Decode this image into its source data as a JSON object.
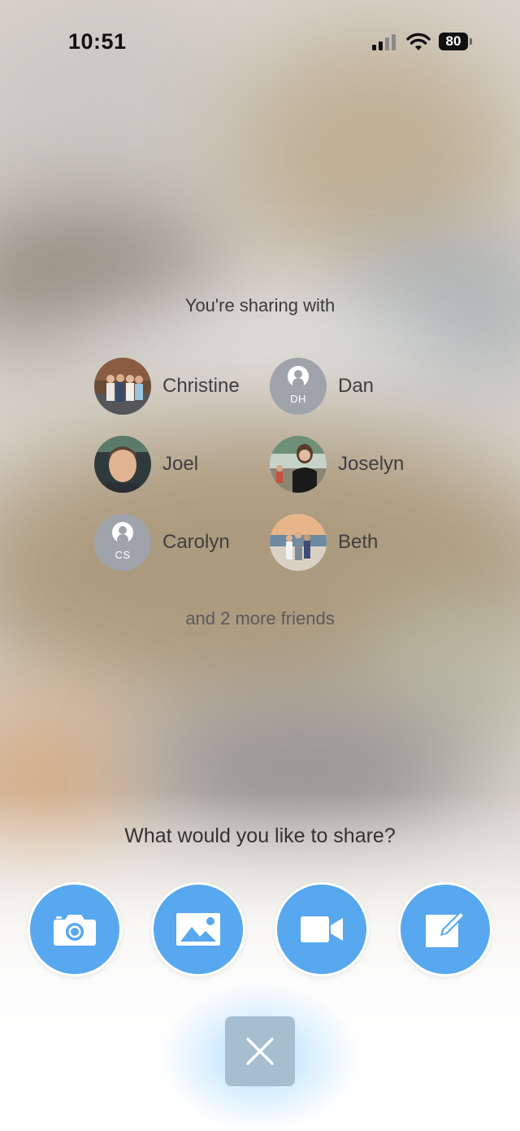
{
  "status_bar": {
    "time": "10:51",
    "battery": "80"
  },
  "sharing": {
    "heading": "You're sharing with",
    "friends": [
      {
        "name": "Christine",
        "avatar": "photo"
      },
      {
        "name": "Dan",
        "avatar": "generic",
        "initials": "DH"
      },
      {
        "name": "Joel",
        "avatar": "photo"
      },
      {
        "name": "Joselyn",
        "avatar": "photo"
      },
      {
        "name": "Carolyn",
        "avatar": "generic",
        "initials": "CS"
      },
      {
        "name": "Beth",
        "avatar": "photo"
      }
    ],
    "more": "and 2 more friends"
  },
  "share_prompt": "What would you like to share?",
  "actions": [
    {
      "icon": "camera-icon"
    },
    {
      "icon": "image-icon"
    },
    {
      "icon": "video-icon"
    },
    {
      "icon": "compose-icon"
    }
  ],
  "close_icon": "close-icon",
  "colors": {
    "accent": "#57a8ee",
    "close_button": "#a5bfd1",
    "text": "#3f3f3f"
  }
}
